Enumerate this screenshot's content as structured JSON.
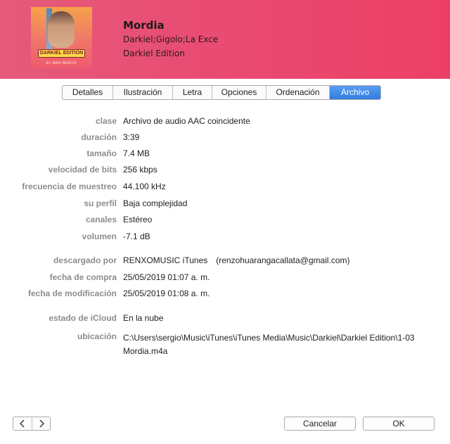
{
  "header": {
    "title": "Mordia",
    "artist": "Darkiel;Gigolo;La Exce",
    "album": "Darkiel Edition",
    "cover_logo_text": "DARKIEL EDITION",
    "cover_sub_text": "EL MAS NUEVO"
  },
  "tabs": [
    {
      "label": "Detalles",
      "active": false
    },
    {
      "label": "Ilustración",
      "active": false
    },
    {
      "label": "Letra",
      "active": false
    },
    {
      "label": "Opciones",
      "active": false
    },
    {
      "label": "Ordenación",
      "active": false
    },
    {
      "label": "Archivo",
      "active": true
    }
  ],
  "fields": {
    "clase": {
      "label": "clase",
      "value": "Archivo de audio AAC coincidente"
    },
    "duracion": {
      "label": "duración",
      "value": "3:39"
    },
    "tamano": {
      "label": "tamaño",
      "value": "7.4 MB"
    },
    "velocidad": {
      "label": "velocidad de bits",
      "value": "256 kbps"
    },
    "frecuencia": {
      "label": "frecuencia de muestreo",
      "value": "44.100 kHz"
    },
    "perfil": {
      "label": "su perfil",
      "value": "Baja complejidad"
    },
    "canales": {
      "label": "canales",
      "value": "Estéreo"
    },
    "volumen": {
      "label": "volumen",
      "value": "-7.1 dB"
    },
    "descargado": {
      "label": "descargado por",
      "value": "RENXOMUSIC iTunes",
      "email": "(renzohuarangacallata@gmail.com)"
    },
    "compra": {
      "label": "fecha de compra",
      "value": "25/05/2019 01:07 a. m."
    },
    "modificacion": {
      "label": "fecha de modificación",
      "value": "25/05/2019 01:08 a. m."
    },
    "icloud": {
      "label": "estado de iCloud",
      "value": "En la nube"
    },
    "ubicacion": {
      "label": "ubicación",
      "value": "C:\\Users\\sergio\\Music\\iTunes\\iTunes Media\\Music\\Darkiel\\Darkiel Edition\\1-03 Mordia.m4a"
    }
  },
  "footer": {
    "prev_icon": "chevron-left-icon",
    "next_icon": "chevron-right-icon",
    "cancel_label": "Cancelar",
    "ok_label": "OK"
  },
  "colors": {
    "header_gradient_start": "#e55a7a",
    "header_gradient_end": "#ec3f66",
    "active_tab": "#2f7ce0",
    "label_gray": "#8d8d8d"
  }
}
